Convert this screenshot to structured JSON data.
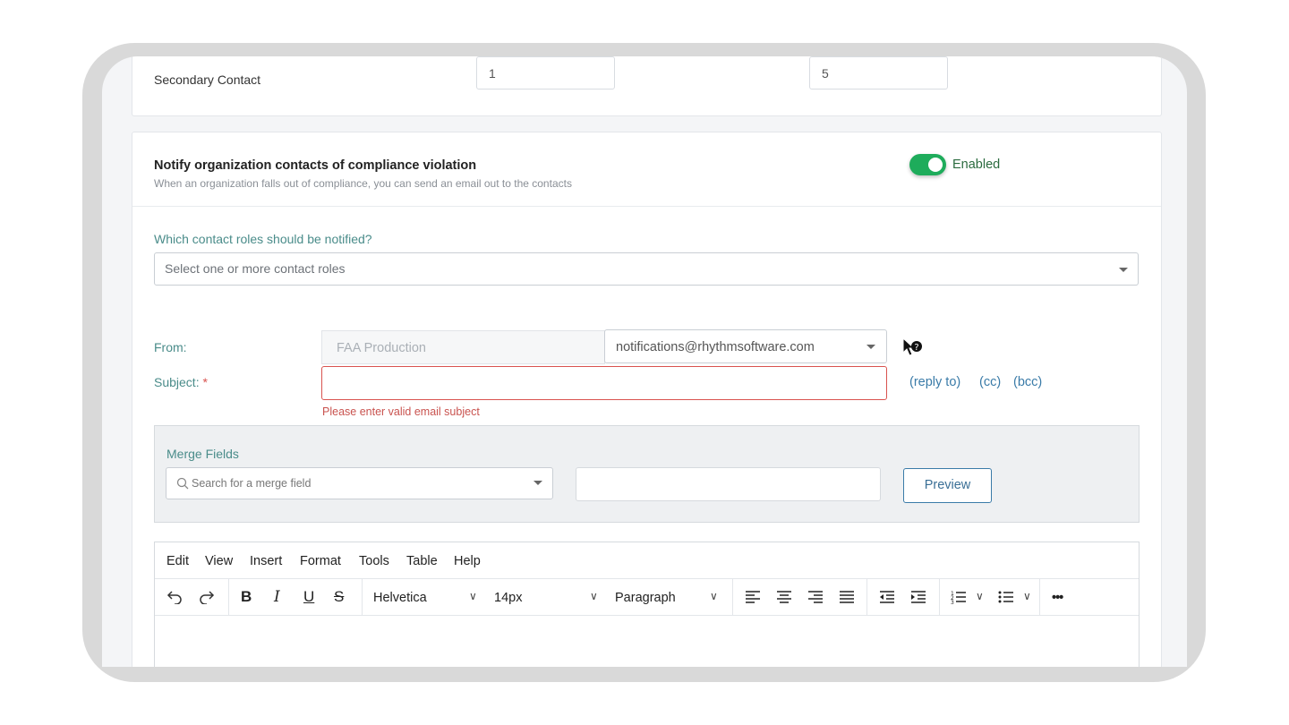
{
  "secondary_contact": {
    "label": "Secondary Contact",
    "value1": "1",
    "value2": "5"
  },
  "notify_section": {
    "title": "Notify organization contacts of compliance violation",
    "subtitle": "When an organization falls out of compliance, you can send an email out to the contacts",
    "toggle_label": "Enabled",
    "toggle_on": true
  },
  "roles": {
    "label": "Which contact roles should be notified?",
    "placeholder": "Select one or more contact roles"
  },
  "email": {
    "from_label": "From:",
    "from_name": "FAA Production",
    "from_address": "notifications@rhythmsoftware.com",
    "subject_label": "Subject:",
    "required_marker": "*",
    "subject_value": "",
    "subject_error": "Please enter valid email subject",
    "links": [
      "(reply to)",
      "(cc)",
      "(bcc)"
    ]
  },
  "merge": {
    "label": "Merge Fields",
    "search_placeholder": "Search for a merge field",
    "preview_label": "Preview"
  },
  "editor": {
    "menu": [
      "Edit",
      "View",
      "Insert",
      "Format",
      "Tools",
      "Table",
      "Help"
    ],
    "font_family": "Helvetica",
    "font_size": "14px",
    "block_format": "Paragraph",
    "more_label": "•••"
  },
  "colors": {
    "accent_teal": "#4a8c8a",
    "toggle_green": "#1eac5b",
    "error_red": "#d9534f",
    "link_blue": "#3a7ba8"
  }
}
